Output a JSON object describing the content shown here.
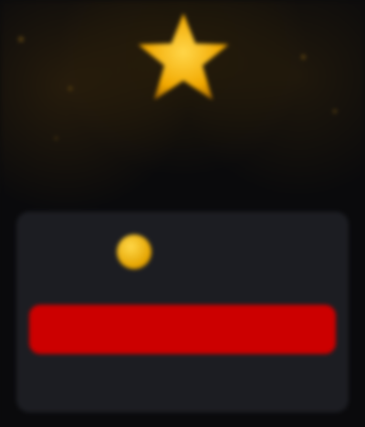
{
  "reward": {
    "title": "",
    "subtitle": "",
    "icon": "star-icon",
    "accent": "#f5b40a"
  },
  "card": {
    "coin_icon": "coin-icon",
    "balance": "",
    "button_label": "",
    "button_color": "#cc0000",
    "secondary_text": ""
  }
}
